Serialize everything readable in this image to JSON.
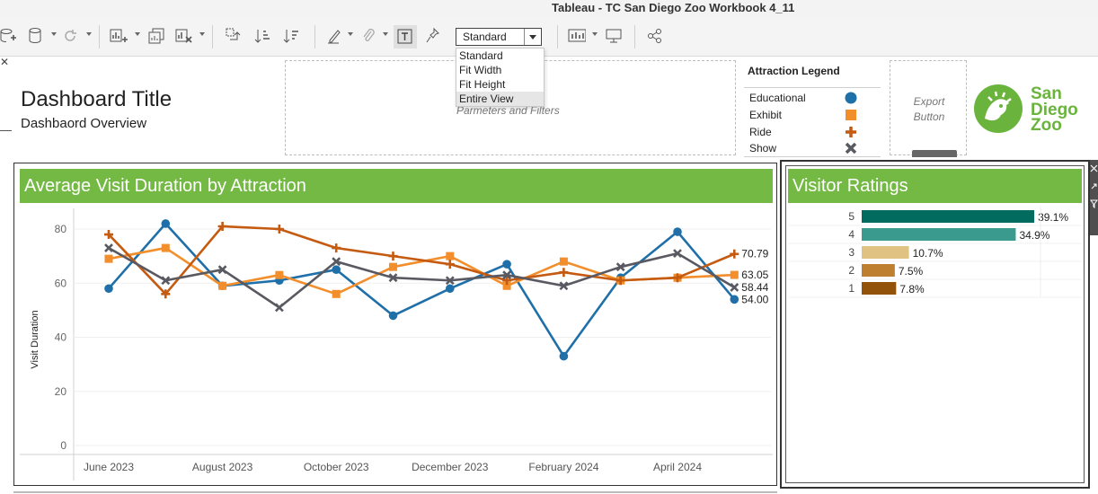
{
  "window": {
    "title": "Tableau - TC San Diego Zoo Workbook 4_11"
  },
  "toolbar": {
    "fit_selected": "Standard",
    "fit_options": [
      "Standard",
      "Fit Width",
      "Fit Height",
      "Entire View"
    ],
    "fit_highlighted": "Entire View",
    "icons": [
      "new-data-source-icon",
      "datasource-icon",
      "refresh-icon",
      "new-worksheet-icon",
      "duplicate-icon",
      "clear-icon",
      "swap-icon",
      "sort-asc-icon",
      "sort-desc-icon",
      "highlight-icon",
      "group-icon",
      "show-labels-icon",
      "fix-axes-icon",
      "show-me-icon",
      "presentation-icon",
      "share-icon"
    ]
  },
  "dashboard": {
    "title": "Dashboard Title",
    "subtitle": "Dashbaord Overview",
    "params_placeholder": "Parmeters and Filters",
    "export_line1": "Export",
    "export_line2": "Button"
  },
  "legend": {
    "title": "Attraction Legend",
    "items": [
      {
        "name": "Educational",
        "shape": "circle",
        "color": "#1f6fa8"
      },
      {
        "name": "Exhibit",
        "shape": "square",
        "color": "#f28e2b"
      },
      {
        "name": "Ride",
        "shape": "plus",
        "color": "#c55a11"
      },
      {
        "name": "Show",
        "shape": "cross",
        "color": "#595961"
      }
    ]
  },
  "logo": {
    "line1": "San",
    "line2": "Diego",
    "line3": "Zoo",
    "color": "#6ab43e"
  },
  "colors": {
    "banner": "#74b944"
  },
  "chart_data": [
    {
      "type": "line",
      "title": "Average Visit Duration by Attraction",
      "ylabel": "Visit Duration",
      "xlabel": "",
      "ylim": [
        0,
        85
      ],
      "yticks": [
        0,
        20,
        40,
        60,
        80
      ],
      "x": [
        "2023-06",
        "2023-07",
        "2023-08",
        "2023-09",
        "2023-10",
        "2023-11",
        "2023-12",
        "2024-01",
        "2024-02",
        "2024-03",
        "2024-04",
        "2024-05"
      ],
      "xtick_labels": [
        {
          "x": "2023-06",
          "label": "June 2023"
        },
        {
          "x": "2023-08",
          "label": "August 2023"
        },
        {
          "x": "2023-10",
          "label": "October 2023"
        },
        {
          "x": "2023-12",
          "label": "December 2023"
        },
        {
          "x": "2024-02",
          "label": "February 2024"
        },
        {
          "x": "2024-04",
          "label": "April 2024"
        }
      ],
      "grid": true,
      "series": [
        {
          "name": "Educational",
          "color": "#1f6fa8",
          "marker": "circle",
          "values": [
            58,
            82,
            59,
            61,
            65,
            48,
            58,
            67,
            33,
            62,
            79,
            54.0
          ],
          "end_label": "54.00"
        },
        {
          "name": "Exhibit",
          "color": "#f28e2b",
          "marker": "square",
          "values": [
            69,
            73,
            59,
            63,
            56,
            66,
            70,
            59,
            68,
            61,
            62,
            63.05
          ],
          "end_label": "63.05"
        },
        {
          "name": "Ride",
          "color": "#c55a11",
          "marker": "plus",
          "values": [
            78,
            56,
            81,
            80,
            73,
            70,
            67,
            61,
            64,
            61,
            62,
            70.79
          ],
          "end_label": "70.79"
        },
        {
          "name": "Show",
          "color": "#595961",
          "marker": "cross",
          "values": [
            73,
            61,
            65,
            51,
            68,
            62,
            61,
            63,
            59,
            66,
            71,
            58.44
          ],
          "end_label": "58.44"
        }
      ]
    },
    {
      "type": "bar",
      "orientation": "horizontal",
      "title": "Visitor Ratings",
      "categories": [
        "5",
        "4",
        "3",
        "2",
        "1"
      ],
      "values": [
        39.1,
        34.9,
        10.7,
        7.5,
        7.8
      ],
      "value_labels": [
        "39.1%",
        "34.9%",
        "10.7%",
        "7.5%",
        "7.8%"
      ],
      "colors": [
        "#006b5e",
        "#3a9a8e",
        "#e0c383",
        "#bf7f31",
        "#935209"
      ]
    }
  ]
}
